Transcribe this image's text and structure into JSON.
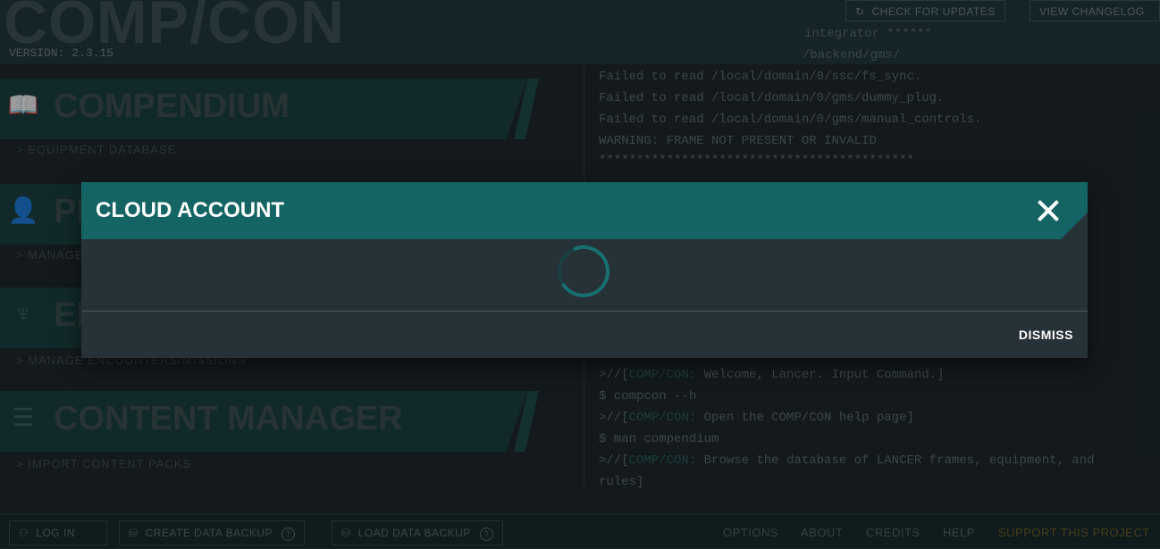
{
  "app": {
    "title": "COMP/CON",
    "version": "VERSION: 2.3.15"
  },
  "top_buttons": {
    "check_updates": "CHECK FOR UPDATES",
    "changelog": "VIEW CHANGELOG"
  },
  "menu": [
    {
      "label": "COMPENDIUM",
      "sub": "> EQUIPMENT DATABASE",
      "icon": "book-icon"
    },
    {
      "label": "PI",
      "sub": "> MANAGE",
      "icon": "pilot-icon"
    },
    {
      "label": "EN",
      "sub": "> MANAGE ENCOUNTERS/MISSIONS",
      "icon": "encounter-icon"
    },
    {
      "label": "CONTENT MANAGER",
      "sub": "> IMPORT CONTENT PACKS",
      "icon": "layers-icon"
    }
  ],
  "console": {
    "lines": [
      "integrator ******",
      "/backend/gms/",
      "Failed to read /local/domain/0/ssc/fs_sync.",
      "Failed to read /local/domain/0/gms/dummy_plug.",
      "Failed to read /local/domain/0/gms/manual_controls.",
      "WARNING: FRAME NOT PRESENT OR INVALID",
      "******************************************"
    ],
    "prompt1_pre": ">//[",
    "prompt1_cc": "COMP/CON:",
    "prompt1_text": " Welcome, Lancer. Input Command.]",
    "cmd1": "$ compcon --h",
    "prompt2_pre": ">//[",
    "prompt2_cc": "COMP/CON:",
    "prompt2_text": " Open the COMP/CON help page]",
    "cmd2": "$ man compendium",
    "prompt3_pre": ">//[",
    "prompt3_cc": "COMP/CON:",
    "prompt3_text": " Browse the database of LANCER frames, equipment, and",
    "prompt3_cont": "rules]"
  },
  "footer": {
    "login": "LOG IN",
    "create_backup": "CREATE DATA BACKUP",
    "load_backup": "LOAD DATA BACKUP",
    "options": "OPTIONS",
    "about": "ABOUT",
    "credits": "CREDITS",
    "help": "HELP",
    "support": "SUPPORT THIS PROJECT"
  },
  "dialog": {
    "title": "CLOUD ACCOUNT",
    "dismiss": "DISMISS",
    "close_icon": "close-icon",
    "spinner": "loading-spinner"
  },
  "colors": {
    "accent": "#146464",
    "dialog_bg": "#263238",
    "support": "#6b5a24"
  }
}
